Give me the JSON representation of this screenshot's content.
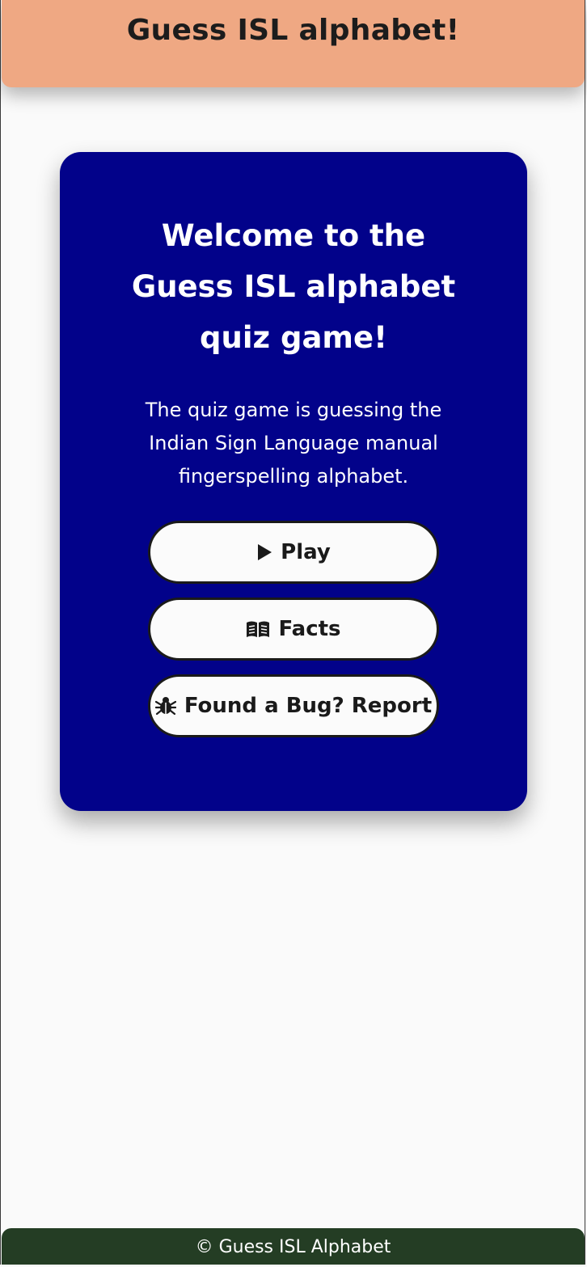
{
  "header": {
    "title": "Guess ISL alphabet!"
  },
  "card": {
    "heading": "Welcome to the Guess ISL alphabet quiz game!",
    "description": "The quiz game is guessing the Indian Sign Language manual fingerspelling alphabet.",
    "buttons": {
      "play": {
        "label": "Play",
        "icon": "play-icon"
      },
      "facts": {
        "label": "Facts",
        "icon": "book-open-icon"
      },
      "report": {
        "label": "Found a Bug? Report",
        "icon": "bug-icon"
      }
    }
  },
  "footer": {
    "text": "© Guess ISL Alphabet"
  },
  "colors": {
    "header_bg": "#efa883",
    "card_bg": "#02028a",
    "button_bg": "#fbfbfb",
    "footer_bg": "#243d24",
    "page_bg": "#fafafa"
  }
}
